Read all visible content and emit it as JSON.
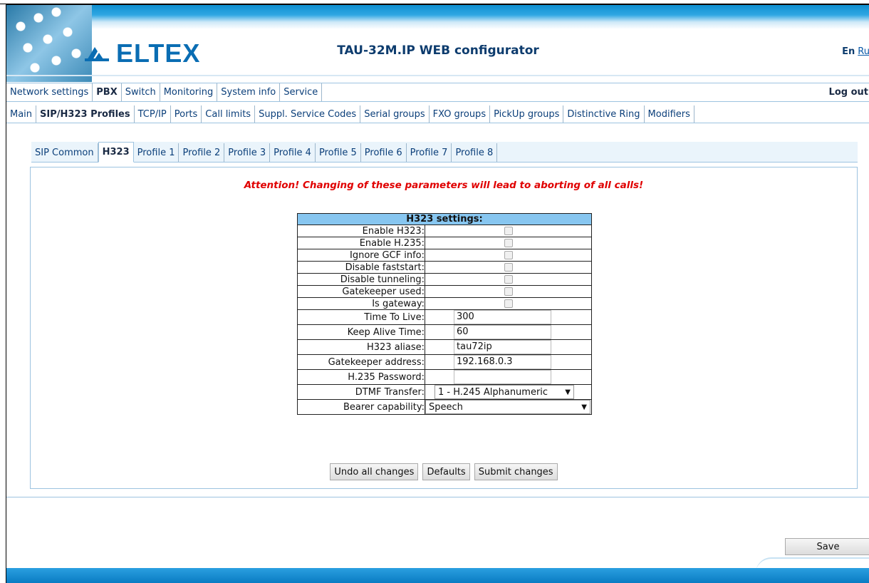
{
  "header": {
    "logo_text": "ELTEX",
    "title": "TAU-32M.IP WEB configurator",
    "lang_en": "En",
    "lang_ru": "Ru"
  },
  "main_nav": {
    "items": [
      "Network settings",
      "PBX",
      "Switch",
      "Monitoring",
      "System info",
      "Service"
    ],
    "active": "PBX",
    "logout": "Log out"
  },
  "sub_nav": {
    "items": [
      "Main",
      "SIP/H323 Profiles",
      "TCP/IP",
      "Ports",
      "Call limits",
      "Suppl. Service Codes",
      "Serial groups",
      "FXO groups",
      "PickUp groups",
      "Distinctive Ring",
      "Modifiers"
    ],
    "active": "SIP/H323 Profiles"
  },
  "profile_tabs": {
    "items": [
      "SIP Common",
      "H323",
      "Profile 1",
      "Profile 2",
      "Profile 3",
      "Profile 4",
      "Profile 5",
      "Profile 6",
      "Profile 7",
      "Profile 8"
    ],
    "active": "H323"
  },
  "attention": "Attention! Changing of these parameters will lead to aborting of all calls!",
  "settings": {
    "heading": "H323 settings:",
    "checkboxes": [
      {
        "label": "Enable H323:",
        "checked": false
      },
      {
        "label": "Enable H.235:",
        "checked": false
      },
      {
        "label": "Ignore GCF info:",
        "checked": false
      },
      {
        "label": "Disable faststart:",
        "checked": false
      },
      {
        "label": "Disable tunneling:",
        "checked": false
      },
      {
        "label": "Gatekeeper used:",
        "checked": false
      },
      {
        "label": "Is gateway:",
        "checked": false
      }
    ],
    "fields": [
      {
        "label": "Time To Live:",
        "value": "300"
      },
      {
        "label": "Keep Alive Time:",
        "value": "60"
      },
      {
        "label": "H323 aliase:",
        "value": "tau72ip"
      },
      {
        "label": "Gatekeeper address:",
        "value": "192.168.0.3"
      },
      {
        "label": "H.235 Password:",
        "value": ""
      }
    ],
    "dtmf": {
      "label": "DTMF Transfer:",
      "value": "1 - H.245 Alphanumeric"
    },
    "bearer": {
      "label": "Bearer capability:",
      "value": "Speech"
    }
  },
  "buttons": {
    "undo": "Undo all changes",
    "defaults": "Defaults",
    "submit": "Submit changes",
    "save": "Save"
  },
  "colors": {
    "brand": "#0a6db3",
    "attention": "#e00000",
    "table_header": "#87c6f0"
  }
}
